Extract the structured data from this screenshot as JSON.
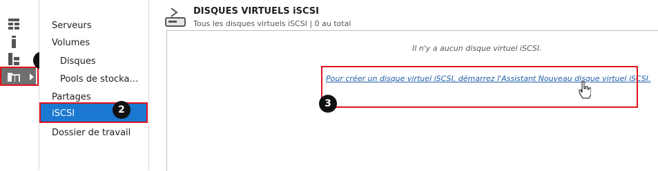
{
  "nav": {
    "items": [
      "Serveurs",
      "Volumes",
      "Disques",
      "Pools de stocka…",
      "Partages",
      "iSCSI",
      "Dossier de travail"
    ],
    "selected": "iSCSI"
  },
  "header": {
    "title": "DISQUES VIRTUELS iSCSI",
    "subtitle": "Tous les disques virtuels iSCSI | 0 au total"
  },
  "content": {
    "empty_message": "Il n'y a aucun disque virtuel iSCSI.",
    "wizard_link": "Pour créer un disque virtuel iSCSI, démarrez l'Assistant Nouveau disque virtuel iSCSI."
  },
  "callouts": [
    "1",
    "2",
    "3"
  ],
  "colors": {
    "selection": "#1b78d0",
    "callout_border": "#e2101b",
    "link": "#1f5fa8",
    "badge": "#111111"
  },
  "icons": {
    "rail": [
      "dashboard-icon",
      "local-server-icon",
      "all-servers-icon",
      "file-storage-icon"
    ],
    "header": "disk-icon",
    "cursor": "hand-cursor-icon"
  }
}
